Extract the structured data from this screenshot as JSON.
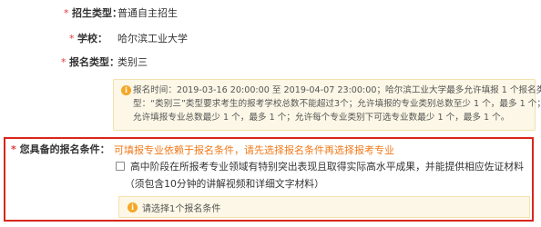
{
  "form": {
    "enroll_type": {
      "required": "*",
      "label": "招生类型：",
      "value": "普通自主招生"
    },
    "school": {
      "required": "*",
      "label": "学校：",
      "value": "哈尔滨工业大学"
    },
    "category": {
      "required": "*",
      "label": "报名类型：",
      "value": "类别三"
    },
    "notice": {
      "icon": "info-icon",
      "icon_glyph": "i",
      "lines": [
        "报名时间：2019-03-16 20:00:00 至 2019-04-07 23:00:00；哈尔滨工业大学最多允许填报 1 个报名类",
        "型：“类别三”类型要求考生的报考学校总数不能超过3个；允许填报的专业类别总数至少 1 个，最多 1 个；",
        "允许填报专业总数最少 1 个，最多 1 个；允许每个专业类别下可选专业数最少 1 个，最多 1 个。"
      ]
    }
  },
  "conditions": {
    "required": "*",
    "label": "您具备的报名条件：",
    "hint": "可填报专业依赖于报名条件，请先选择报名条件再选择报考专业",
    "options": [
      {
        "checked": false,
        "text": "高中阶段在所报考专业领域有特别突出表现且取得实际高水平成果，并能提供相应佐证材料",
        "sub": "（须包含10分钟的讲解视频和详细文字材料）"
      }
    ],
    "warning": {
      "icon": "info-icon",
      "icon_glyph": "i",
      "text": "请选择1个报名条件"
    }
  },
  "colors": {
    "required": "#e33a3a",
    "hint": "#f07a1a",
    "highlight_border": "#d9261c",
    "notice_bg": "#fcf7e6",
    "info_icon": "#f5a623"
  }
}
